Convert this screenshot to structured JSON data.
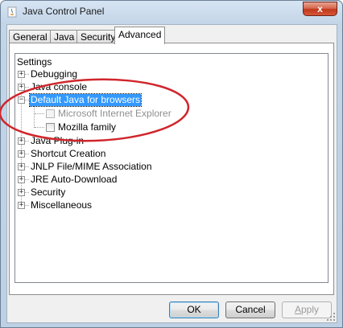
{
  "window": {
    "title": "Java Control Panel",
    "app_icon": "java-cup-icon",
    "close_symbol": "x"
  },
  "tabs": [
    {
      "label": "General",
      "active": false
    },
    {
      "label": "Java",
      "active": false
    },
    {
      "label": "Security",
      "active": false
    },
    {
      "label": "Advanced",
      "active": true
    }
  ],
  "tree": {
    "root": "Settings",
    "items": [
      {
        "label": "Debugging",
        "expanded": false
      },
      {
        "label": "Java console",
        "expanded": false
      },
      {
        "label": "Default Java for browsers",
        "expanded": true,
        "selected": true,
        "children": [
          {
            "label": "Microsoft Internet Explorer",
            "checked": false,
            "enabled": false
          },
          {
            "label": "Mozilla family",
            "checked": false,
            "enabled": true
          }
        ]
      },
      {
        "label": "Java Plug-in",
        "expanded": false
      },
      {
        "label": "Shortcut Creation",
        "expanded": false
      },
      {
        "label": "JNLP File/MIME Association",
        "expanded": false
      },
      {
        "label": "JRE Auto-Download",
        "expanded": false
      },
      {
        "label": "Security",
        "expanded": false
      },
      {
        "label": "Miscellaneous",
        "expanded": false
      }
    ],
    "expand_symbol": "+",
    "collapse_symbol": "−"
  },
  "buttons": {
    "ok": "OK",
    "cancel": "Cancel",
    "apply_mnemonic": "A",
    "apply_rest": "pply"
  },
  "annotation": {
    "color": "#d0262c"
  }
}
